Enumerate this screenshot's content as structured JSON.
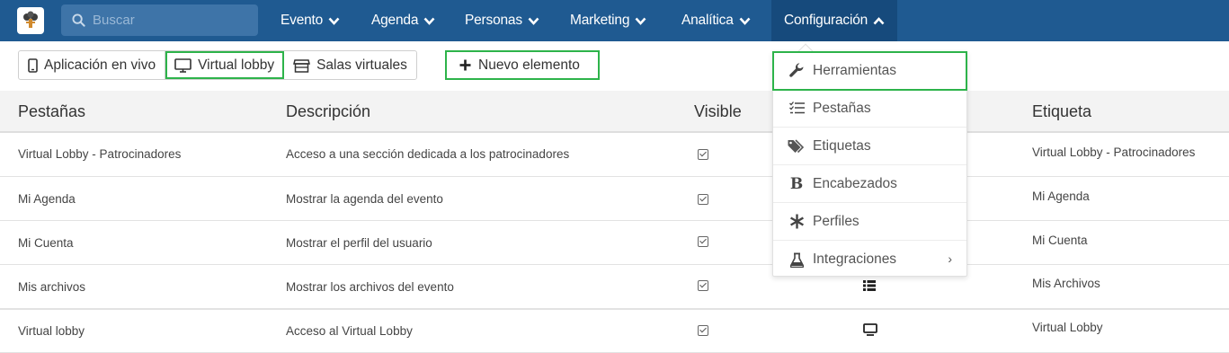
{
  "nav": {
    "search_placeholder": "Buscar",
    "items": [
      {
        "label": "Evento"
      },
      {
        "label": "Agenda"
      },
      {
        "label": "Personas"
      },
      {
        "label": "Marketing"
      },
      {
        "label": "Analítica"
      },
      {
        "label": "Configuración"
      }
    ]
  },
  "toolbar": {
    "segments": [
      {
        "label": "Aplicación en vivo",
        "icon": "mobile-icon"
      },
      {
        "label": "Virtual lobby",
        "icon": "monitor-icon"
      },
      {
        "label": "Salas virtuales",
        "icon": "store-icon"
      }
    ],
    "new_label": "Nuevo elemento"
  },
  "table": {
    "headers": {
      "tabs": "Pestañas",
      "description": "Descripción",
      "visible": "Visible",
      "label": "Etiqueta"
    },
    "rows": [
      {
        "tab": "Virtual Lobby - Patrocinadores",
        "description": "Acceso a una sección dedicada a los patrocinadores",
        "label": "Virtual Lobby - Patrocinadores"
      },
      {
        "tab": "Mi Agenda",
        "description": "Mostrar la agenda del evento",
        "label": "Mi Agenda"
      },
      {
        "tab": "Mi Cuenta",
        "description": "Mostrar el perfil del usuario",
        "label": "Mi Cuenta"
      },
      {
        "tab": "Mis archivos",
        "description": "Mostrar los archivos del evento",
        "label": "Mis Archivos"
      },
      {
        "tab": "Virtual lobby",
        "description": "Acceso al Virtual Lobby",
        "label": "Virtual Lobby"
      }
    ]
  },
  "dropdown": {
    "items": [
      {
        "label": "Herramientas",
        "icon": "wrench-icon"
      },
      {
        "label": "Pestañas",
        "icon": "checklist-icon"
      },
      {
        "label": "Etiquetas",
        "icon": "tags-icon"
      },
      {
        "label": "Encabezados",
        "icon": "bold-icon"
      },
      {
        "label": "Perfiles",
        "icon": "asterisk-icon"
      },
      {
        "label": "Integraciones",
        "icon": "flask-icon",
        "submenu": "›"
      }
    ]
  },
  "colors": {
    "navbar": "#1f5a91",
    "highlight": "#2db34a"
  }
}
